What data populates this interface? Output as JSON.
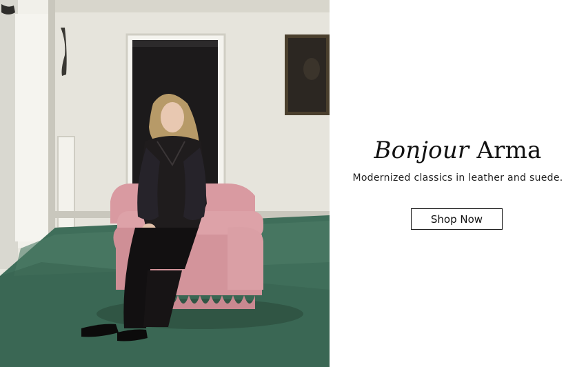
{
  "hero": {
    "headline_italic": "Bonjour",
    "headline_regular": "Arma",
    "subtitle": "Modernized classics in leather and suede.",
    "cta_label": "Shop Now"
  },
  "colors": {
    "background": "#ffffff",
    "text": "#111111",
    "button_border": "#111111"
  }
}
